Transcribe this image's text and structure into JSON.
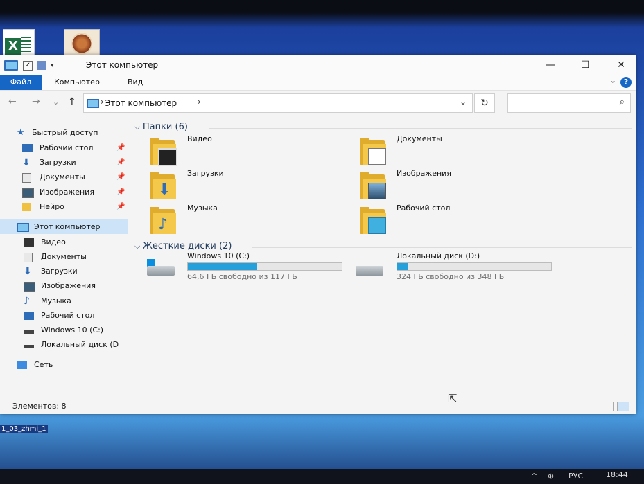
{
  "desktop": {
    "file_label": "1_03_zhmi_1"
  },
  "window": {
    "title": "Этот компьютер",
    "controls": {
      "minimize": "—",
      "maximize": "☐",
      "close": "✕"
    }
  },
  "ribbon": {
    "tabs": [
      "Файл",
      "Компьютер",
      "Вид"
    ],
    "help": "?"
  },
  "address": {
    "path": "Этот компьютер",
    "separator": "›",
    "dropdown": "⌄",
    "refresh": "↻",
    "search_icon": "⌕"
  },
  "nav": {
    "back": "←",
    "forward": "→",
    "recent": "⌄",
    "up": "↑"
  },
  "sidebar": {
    "quick_access": "Быстрый доступ",
    "quick_items": [
      "Рабочий стол",
      "Загрузки",
      "Документы",
      "Изображения",
      "Нейро"
    ],
    "this_pc": "Этот компьютер",
    "pc_items": [
      "Видео",
      "Документы",
      "Загрузки",
      "Изображения",
      "Музыка",
      "Рабочий стол",
      "Windows 10 (C:)",
      "Локальный диск (D"
    ],
    "network": "Сеть"
  },
  "content": {
    "folders_header": "Папки (6)",
    "folders": [
      "Видео",
      "Документы",
      "Загрузки",
      "Изображения",
      "Музыка",
      "Рабочий стол"
    ],
    "drives_header": "Жесткие диски (2)",
    "drives": [
      {
        "name": "Windows 10 (C:)",
        "free": "64,6 ГБ свободно из 117 ГБ",
        "used_fraction": 0.45
      },
      {
        "name": "Локальный диск (D:)",
        "free": "324 ГБ свободно из 348 ГБ",
        "used_fraction": 0.07
      }
    ]
  },
  "status": {
    "count": "Элементов: 8"
  },
  "taskbar": {
    "lang": "РУС",
    "time": "18:44"
  },
  "colors": {
    "accent": "#1666c5",
    "selection": "#cde3f7",
    "drive_bar": "#26a0da",
    "folder": "#f4c84a"
  }
}
